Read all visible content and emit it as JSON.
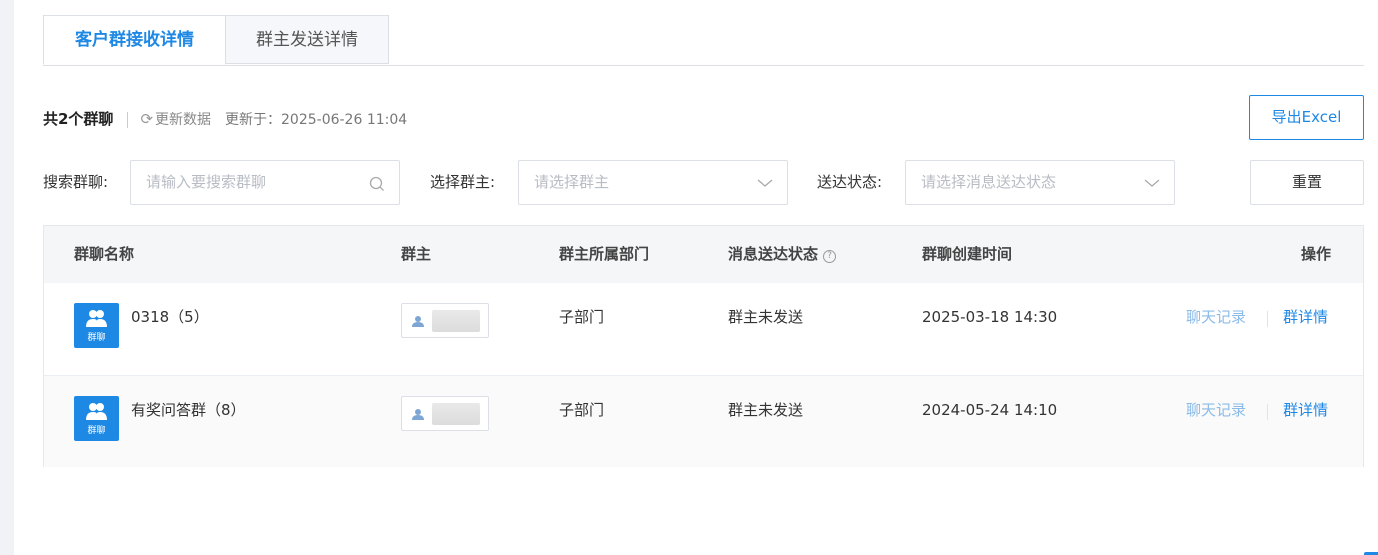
{
  "tabs": [
    {
      "label": "客户群接收详情",
      "active": true
    },
    {
      "label": "群主发送详情",
      "active": false
    }
  ],
  "summary": {
    "count_text": "共2个群聊",
    "refresh_label": "更新数据",
    "updated_text": "更新于：2025-06-26 11:04"
  },
  "export_label": "导出Excel",
  "filters": {
    "search": {
      "label": "搜索群聊:",
      "placeholder": "请输入要搜索群聊"
    },
    "owner": {
      "label": "选择群主:",
      "placeholder": "请选择群主"
    },
    "status": {
      "label": "送达状态:",
      "placeholder": "请选择消息送达状态"
    },
    "reset_label": "重置"
  },
  "table": {
    "columns": [
      "群聊名称",
      "群主",
      "群主所属部门",
      "消息送达状态",
      "群聊创建时间",
      "操作"
    ],
    "avatar_label": "群聊",
    "rows": [
      {
        "name": "0318（5）",
        "department": "子部门",
        "status": "群主未发送",
        "created": "2025-03-18 14:30",
        "action_chat": "聊天记录",
        "action_detail": "群详情"
      },
      {
        "name": "有奖问答群（8）",
        "department": "子部门",
        "status": "群主未发送",
        "created": "2024-05-24 14:10",
        "action_chat": "聊天记录",
        "action_detail": "群详情"
      }
    ]
  },
  "colors": {
    "accent": "#1e88e5",
    "chat_link": "#8bbbe8",
    "border": "#dcdfe6"
  },
  "icons": [
    "refresh-icon",
    "search-icon",
    "chevron-down-icon",
    "help-icon",
    "group-avatar-icon",
    "user-icon"
  ]
}
